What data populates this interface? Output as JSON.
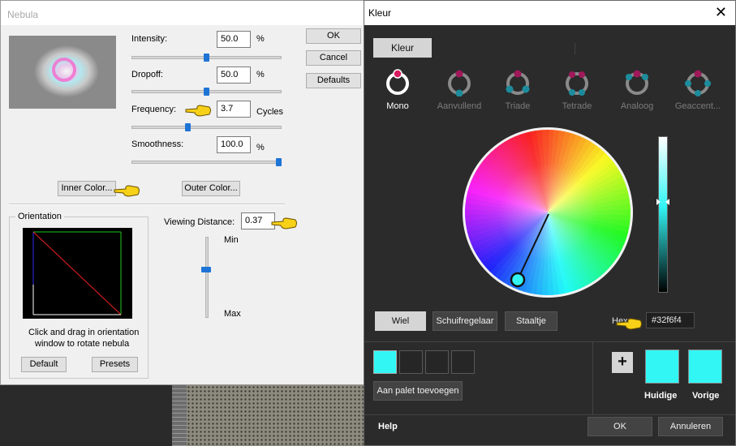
{
  "nebula": {
    "title": "Nebula",
    "intensity": {
      "label": "Intensity:",
      "value": "50.0",
      "unit": "%",
      "slider": 0.5
    },
    "dropoff": {
      "label": "Dropoff:",
      "value": "50.0",
      "unit": "%",
      "slider": 0.5
    },
    "frequency": {
      "label": "Frequency:",
      "value": "3.7",
      "unit": "Cycles",
      "slider": 0.37
    },
    "smoothness": {
      "label": "Smoothness:",
      "value": "100.0",
      "unit": "%",
      "slider": 1.0
    },
    "ok": "OK",
    "cancel": "Cancel",
    "defaults": "Defaults",
    "inner_color": "Inner Color...",
    "outer_color": "Outer Color...",
    "orientation": "Orientation",
    "viewing_distance": {
      "label": "Viewing Distance:",
      "value": "0.37",
      "slider": 0.37
    },
    "min": "Min",
    "max": "Max",
    "hint_line1": "Click and drag in orientation",
    "hint_line2": "window to rotate nebula",
    "default_btn": "Default",
    "presets_btn": "Presets"
  },
  "kleur": {
    "title": "Kleur",
    "close": "✕",
    "tab": "Kleur",
    "harmonies": [
      {
        "label": "Mono",
        "selected": true
      },
      {
        "label": "Aanvullend",
        "selected": false
      },
      {
        "label": "Triade",
        "selected": false
      },
      {
        "label": "Tetrade",
        "selected": false
      },
      {
        "label": "Analoog",
        "selected": false
      },
      {
        "label": "Geaccent...",
        "selected": false
      }
    ],
    "modes": [
      "Wiel",
      "Schuifregelaar",
      "Staaltje"
    ],
    "active_mode": "Wiel",
    "hex_label": "Hex:",
    "hex_value": "#32f6f4",
    "add_to_palette": "Aan palet toevoegen",
    "current_label": "Huidige",
    "previous_label": "Vorige",
    "help": "Help",
    "ok": "OK",
    "cancel": "Annuleren",
    "colors": {
      "current": "#32f6f4",
      "previous": "#32f6f4",
      "accent": "#d81b60"
    }
  }
}
